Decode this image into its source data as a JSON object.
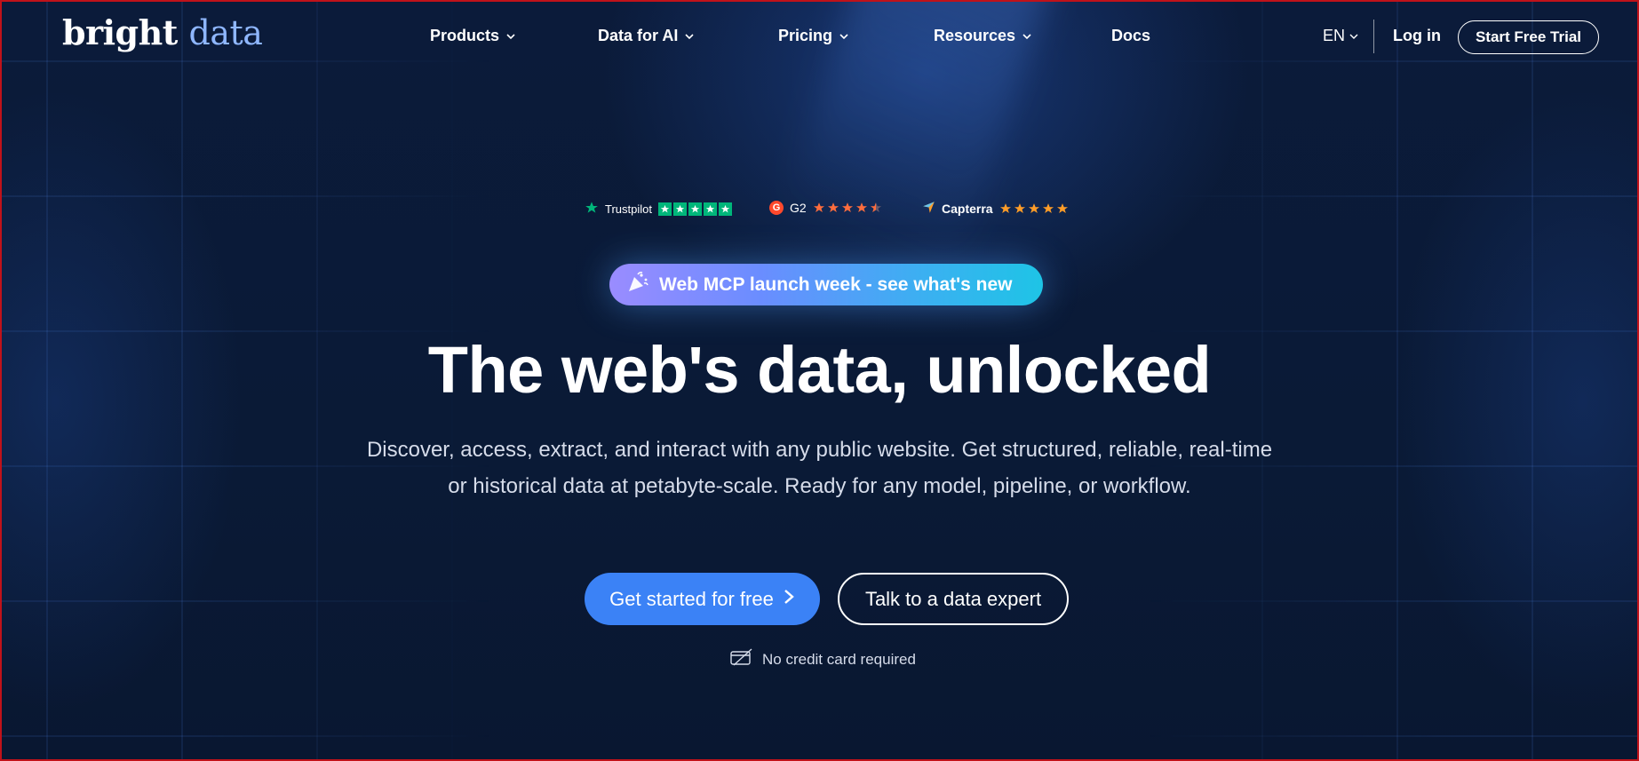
{
  "brand": {
    "logo_word1": "bright",
    "logo_word2": "data"
  },
  "nav": {
    "items": [
      {
        "label": "Products",
        "has_dropdown": true
      },
      {
        "label": "Data for AI",
        "has_dropdown": true
      },
      {
        "label": "Pricing",
        "has_dropdown": true
      },
      {
        "label": "Resources",
        "has_dropdown": true
      },
      {
        "label": "Docs",
        "has_dropdown": false
      }
    ],
    "language": "EN",
    "login": "Log in",
    "trial": "Start Free Trial"
  },
  "ratings": {
    "trustpilot": {
      "name": "Trustpilot",
      "stars": 5
    },
    "g2": {
      "name": "G2",
      "badge": "G",
      "stars": 4.5
    },
    "capterra": {
      "name": "Capterra",
      "stars": 5
    }
  },
  "announcement": {
    "label": "Web MCP launch week - see what's new",
    "icon": "party-popper-icon"
  },
  "hero": {
    "headline": "The web's data, unlocked",
    "subline_1": "Discover, access, extract, and interact with any public website. Get structured, reliable, real-time",
    "subline_2": "or historical data at petabyte-scale. Ready for any model, pipeline, or workflow."
  },
  "cta": {
    "primary": "Get started for free",
    "secondary": "Talk to a data expert",
    "note": "No credit card required"
  },
  "colors": {
    "background": "#0a1a35",
    "primary_button": "#3b82f6",
    "trustpilot_green": "#00b67a",
    "g2_red": "#ff492c",
    "star_orange": "#ff6d3d",
    "capterra_star": "#ff9d28",
    "logo_accent": "#8fb7ff"
  }
}
